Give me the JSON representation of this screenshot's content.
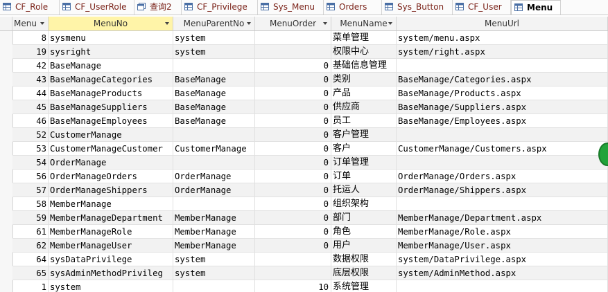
{
  "tabs": [
    {
      "label": "CF_Role",
      "icon": "table-icon",
      "active": false
    },
    {
      "label": "CF_UserRole",
      "icon": "table-icon",
      "active": false
    },
    {
      "label": "查询2",
      "icon": "query-icon",
      "active": false
    },
    {
      "label": "CF_Privilege",
      "icon": "table-icon",
      "active": false
    },
    {
      "label": "Sys_Menu",
      "icon": "table-icon",
      "active": false
    },
    {
      "label": "Orders",
      "icon": "table-icon",
      "active": false
    },
    {
      "label": "Sys_Button",
      "icon": "table-icon",
      "active": false
    },
    {
      "label": "CF_User",
      "icon": "table-icon",
      "active": false
    },
    {
      "label": "Menu",
      "icon": "table-icon",
      "active": true
    }
  ],
  "columns": {
    "id": "Menu",
    "menu_no": "MenuNo",
    "parent": "MenuParentNo",
    "order": "MenuOrder",
    "name": "MenuName",
    "url": "MenuUrl"
  },
  "rows": [
    {
      "id": "8",
      "menu_no": "sysmenu",
      "parent": "system",
      "order": "",
      "name": "菜单管理",
      "url": "system/menu.aspx"
    },
    {
      "id": "19",
      "menu_no": "sysright",
      "parent": "system",
      "order": "",
      "name": "权限中心",
      "url": "system/right.aspx"
    },
    {
      "id": "42",
      "menu_no": "BaseManage",
      "parent": "",
      "order": "0",
      "name": "基础信息管理",
      "url": ""
    },
    {
      "id": "43",
      "menu_no": "BaseManageCategories",
      "parent": "BaseManage",
      "order": "0",
      "name": "类别",
      "url": "BaseManage/Categories.aspx"
    },
    {
      "id": "44",
      "menu_no": "BaseManageProducts",
      "parent": "BaseManage",
      "order": "0",
      "name": "产品",
      "url": "BaseManage/Products.aspx"
    },
    {
      "id": "45",
      "menu_no": "BaseManageSuppliers",
      "parent": "BaseManage",
      "order": "0",
      "name": "供应商",
      "url": "BaseManage/Suppliers.aspx"
    },
    {
      "id": "46",
      "menu_no": "BaseManageEmployees",
      "parent": "BaseManage",
      "order": "0",
      "name": "员工",
      "url": "BaseManage/Employees.aspx"
    },
    {
      "id": "52",
      "menu_no": "CustomerManage",
      "parent": "",
      "order": "0",
      "name": "客户管理",
      "url": ""
    },
    {
      "id": "53",
      "menu_no": "CustomerManageCustomer",
      "parent": "CustomerManage",
      "order": "0",
      "name": "客户",
      "url": "CustomerManage/Customers.aspx"
    },
    {
      "id": "54",
      "menu_no": "OrderManage",
      "parent": "",
      "order": "0",
      "name": "订单管理",
      "url": ""
    },
    {
      "id": "56",
      "menu_no": "OrderManageOrders",
      "parent": "OrderManage",
      "order": "0",
      "name": "订单",
      "url": "OrderManage/Orders.aspx"
    },
    {
      "id": "57",
      "menu_no": "OrderManageShippers",
      "parent": "OrderManage",
      "order": "0",
      "name": "托运人",
      "url": "OrderManage/Shippers.aspx"
    },
    {
      "id": "58",
      "menu_no": "MemberManage",
      "parent": "",
      "order": "0",
      "name": "组织架构",
      "url": ""
    },
    {
      "id": "59",
      "menu_no": "MemberManageDepartment",
      "parent": "MemberManage",
      "order": "0",
      "name": "部门",
      "url": "MemberManage/Department.aspx"
    },
    {
      "id": "61",
      "menu_no": "MemberManageRole",
      "parent": "MemberManage",
      "order": "0",
      "name": "角色",
      "url": "MemberManage/Role.aspx"
    },
    {
      "id": "62",
      "menu_no": "MemberManageUser",
      "parent": "MemberManage",
      "order": "0",
      "name": "用户",
      "url": "MemberManage/User.aspx"
    },
    {
      "id": "64",
      "menu_no": "sysDataPrivilege",
      "parent": "system",
      "order": "",
      "name": "数据权限",
      "url": "system/DataPrivilege.aspx"
    },
    {
      "id": "65",
      "menu_no": "sysAdminMethodPrivileg",
      "parent": "system",
      "order": "",
      "name": "底层权限",
      "url": "system/AdminMethod.aspx"
    },
    {
      "id": "1",
      "menu_no": "system",
      "parent": "",
      "order": "10",
      "name": "系统管理",
      "url": ""
    }
  ]
}
